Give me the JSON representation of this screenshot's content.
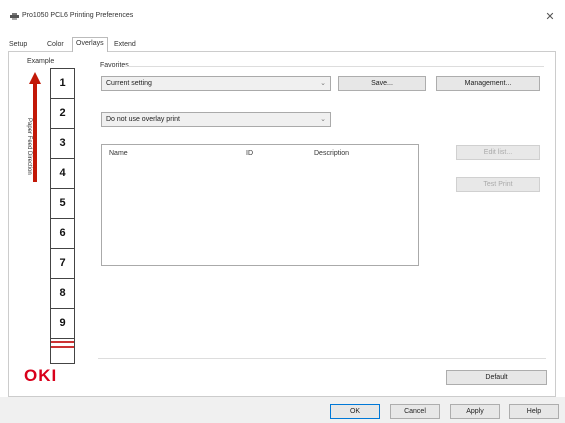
{
  "window": {
    "title": "Pro1050 PCL6 Printing Preferences",
    "close_glyph": "✕",
    "icon": "printer-icon"
  },
  "tabs": [
    {
      "label": "Setup",
      "active": false
    },
    {
      "label": "Color",
      "active": false
    },
    {
      "label": "Overlays",
      "active": true
    },
    {
      "label": "Extend",
      "active": false
    }
  ],
  "example": {
    "label": "Example",
    "feed_direction_label": "Paper Feed Direction",
    "page_numbers": [
      "1",
      "2",
      "3",
      "4",
      "5",
      "6",
      "7",
      "8",
      "9"
    ]
  },
  "favorites": {
    "label": "Favorites",
    "selected": "Current setting",
    "save_label": "Save...",
    "management_label": "Management..."
  },
  "overlay": {
    "selected": "Do not use overlay print",
    "columns": [
      "Name",
      "ID",
      "Description"
    ],
    "edit_label": "Edit list...",
    "test_print_label": "Test Print"
  },
  "default_label": "Default",
  "logo": "OKI",
  "dialog_buttons": {
    "ok": "OK",
    "cancel": "Cancel",
    "apply": "Apply",
    "help": "Help"
  },
  "colors": {
    "brand_red": "#d9001b",
    "arrow_red": "#c21807"
  }
}
